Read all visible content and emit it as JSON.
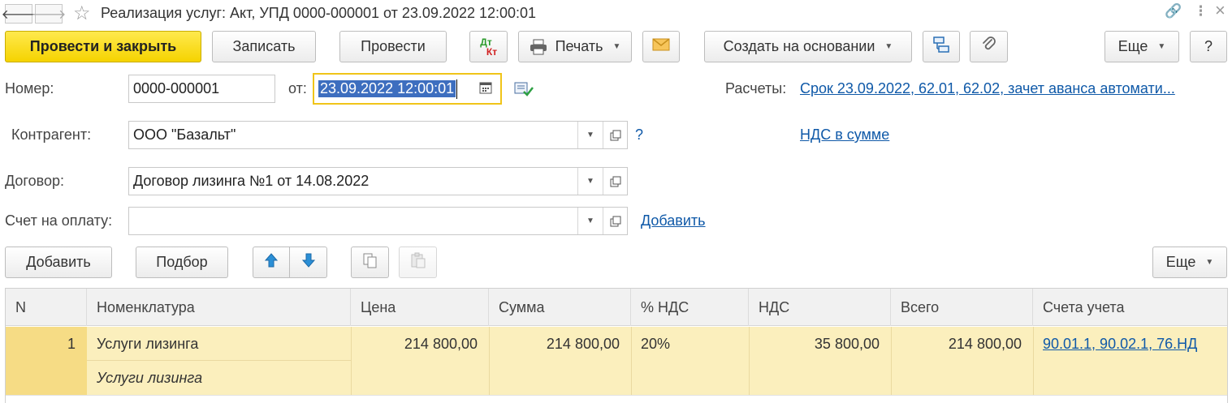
{
  "window": {
    "title": "Реализация услуг: Акт, УПД 0000-000001 от 23.09.2022 12:00:01",
    "back": "🡐",
    "forward": "🡒",
    "star": "☆",
    "link_icon": "🔗",
    "menu_icon": "⋮",
    "close_icon": "×"
  },
  "toolbar": {
    "post_close": "Провести и закрыть",
    "save": "Записать",
    "post": "Провести",
    "dtkt_top": "Дт",
    "dtkt_bottom": "Кт",
    "print": "Печать",
    "create_based": "Создать на основании",
    "more": "Еще",
    "help": "?"
  },
  "form": {
    "number_label": "Номер:",
    "number_value": "0000-000001",
    "date_label": "от:",
    "date_value": "23.09.2022 12:00:01",
    "settlements_label": "Расчеты:",
    "settlements_link": "Срок 23.09.2022, 62.01, 62.02, зачет аванса автомати...",
    "counterparty_label": "Контрагент:",
    "counterparty_value": "ООО \"Базальт\"",
    "question": "?",
    "vat_link": "НДС в сумме",
    "contract_label": "Договор:",
    "contract_value": "Договор лизинга №1 от 14.08.2022",
    "invoice_label": "Счет на оплату:",
    "invoice_value": "",
    "invoice_add": "Добавить"
  },
  "table_toolbar": {
    "add": "Добавить",
    "pick": "Подбор",
    "more": "Еще"
  },
  "table": {
    "headers": [
      "N",
      "Номенклатура",
      "Цена",
      "Сумма",
      "% НДС",
      "НДС",
      "Всего",
      "Счета учета"
    ],
    "rows": [
      {
        "n": "1",
        "item": "Услуги лизинга",
        "item_content": "Услуги лизинга",
        "price": "214 800,00",
        "amount": "214 800,00",
        "vat_rate": "20%",
        "vat": "35 800,00",
        "total": "214 800,00",
        "accounts": "90.01.1, 90.02.1, 76.НД"
      }
    ]
  },
  "colors": {
    "primary": "#f5d300",
    "link": "#0f59a8",
    "row_selected": "#fbefbd",
    "focus": "#f0c419"
  }
}
